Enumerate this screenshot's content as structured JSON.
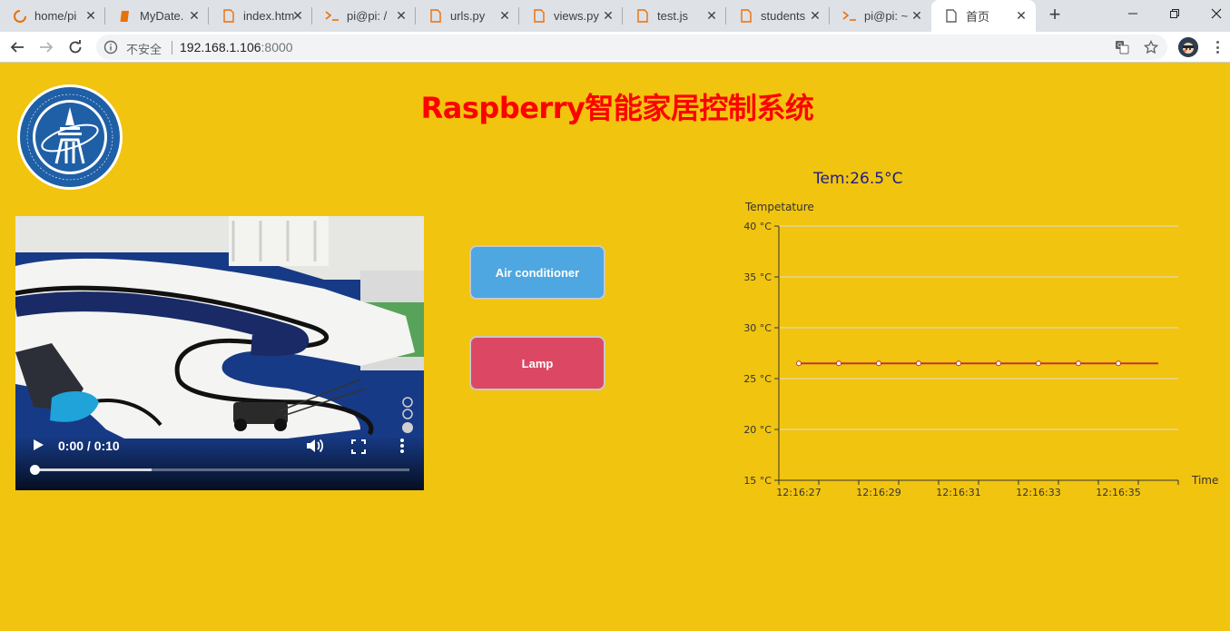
{
  "browser": {
    "tabs": [
      {
        "title": "home/pi",
        "icon": "loading-icon",
        "active": false
      },
      {
        "title": "MyDate.",
        "icon": "book-icon",
        "active": false
      },
      {
        "title": "index.htm",
        "icon": "document-icon",
        "active": false
      },
      {
        "title": "pi@pi: /",
        "icon": "terminal-icon",
        "active": false
      },
      {
        "title": "urls.py",
        "icon": "document-icon",
        "active": false
      },
      {
        "title": "views.py",
        "icon": "document-icon",
        "active": false
      },
      {
        "title": "test.js",
        "icon": "document-icon",
        "active": false
      },
      {
        "title": "students",
        "icon": "document-icon",
        "active": false
      },
      {
        "title": "pi@pi: ~",
        "icon": "terminal-icon",
        "active": false
      },
      {
        "title": "首页",
        "icon": "page-icon",
        "active": true
      }
    ],
    "security_label": "不安全",
    "url_host": "192.168.1.106",
    "url_port": ":8000"
  },
  "page": {
    "title": "Raspberry智能家居控制系统",
    "temperature_readout": "Tem:26.5°C",
    "buttons": {
      "air_conditioner": "Air conditioner",
      "lamp": "Lamp"
    },
    "video": {
      "time": "0:00 / 0:10",
      "progress_played": 0,
      "progress_buffered": 0.31
    }
  },
  "chart_data": {
    "type": "line",
    "ylabel": "Tempetature",
    "xlabel": "Time",
    "ylim": [
      15,
      40
    ],
    "yticks": [
      15,
      20,
      25,
      30,
      35,
      40
    ],
    "y_unit": "°C",
    "x": [
      "12:16:27",
      "12:16:28",
      "12:16:29",
      "12:16:30",
      "12:16:31",
      "12:16:32",
      "12:16:33",
      "12:16:34",
      "12:16:35",
      "12:16:36"
    ],
    "xtick_labels": [
      "12:16:27",
      "12:16:29",
      "12:16:31",
      "12:16:33",
      "12:16:35"
    ],
    "series": [
      {
        "values": [
          26.5,
          26.5,
          26.5,
          26.5,
          26.5,
          26.5,
          26.5,
          26.5,
          26.5,
          26.5
        ],
        "color": "#c23531"
      }
    ],
    "grid": true
  }
}
